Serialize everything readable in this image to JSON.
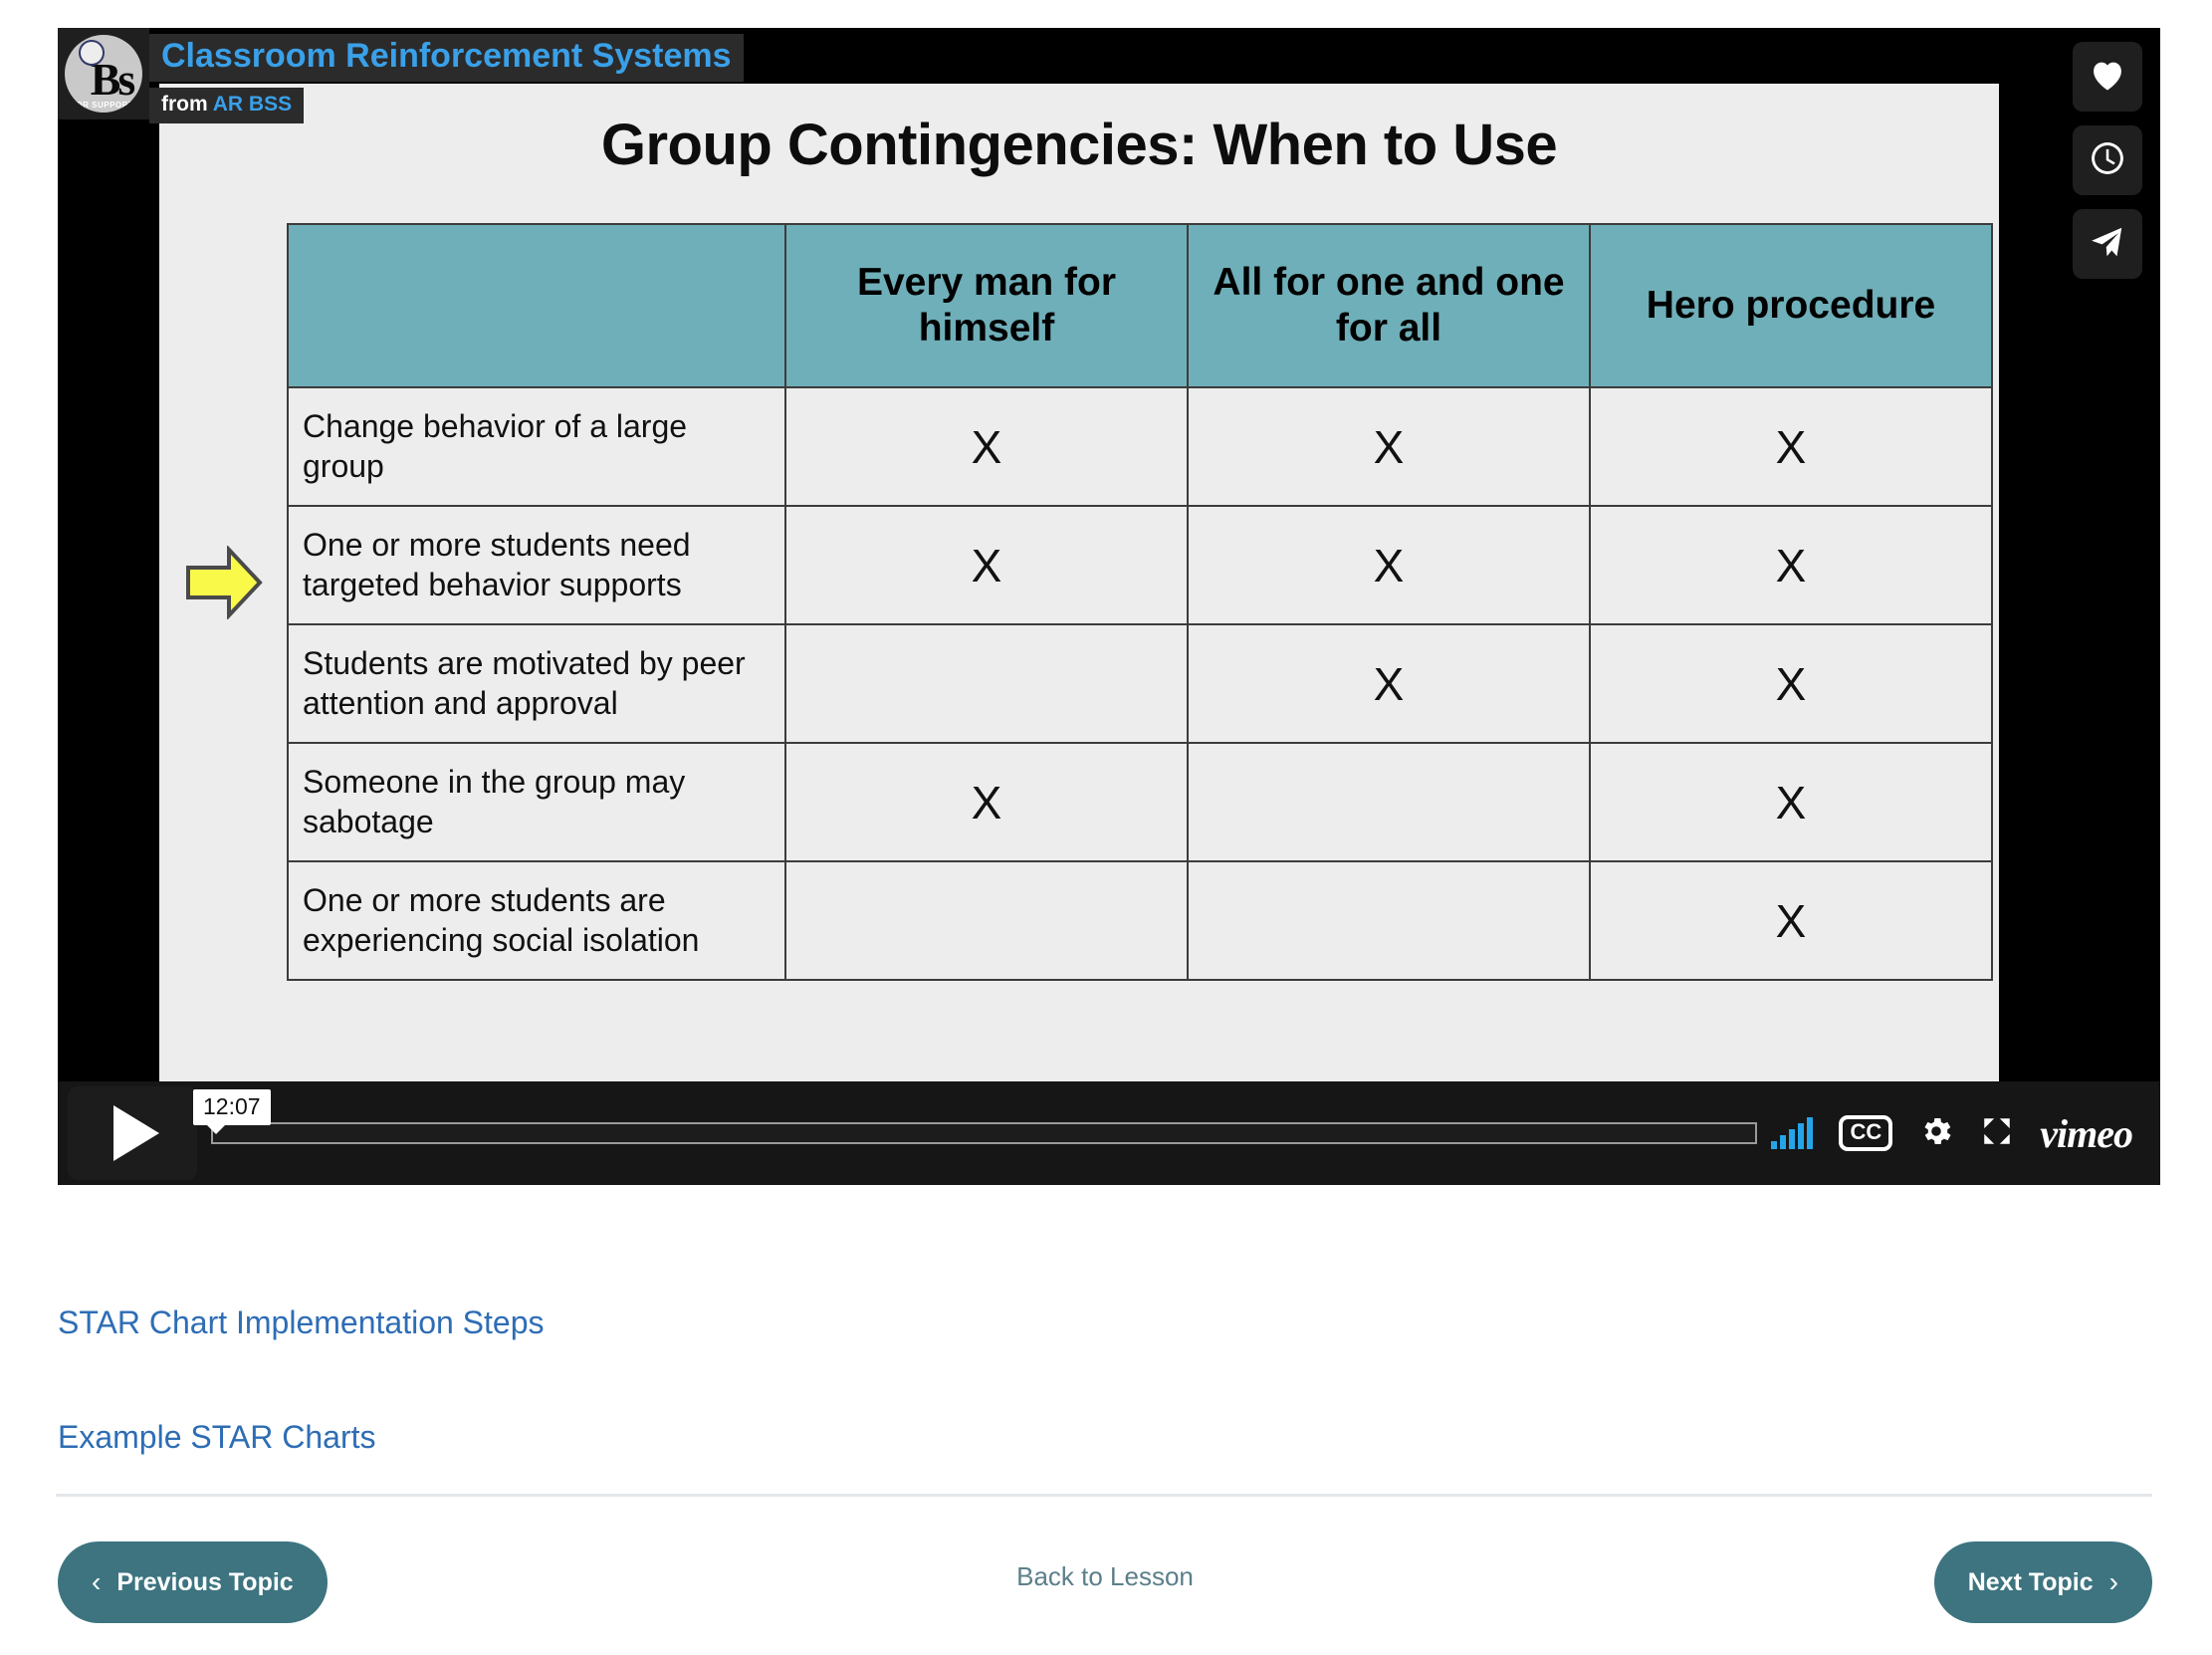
{
  "player": {
    "video_title": "Classroom Reinforcement Systems",
    "from_prefix": "from",
    "from_brand": "AR BSS",
    "avatar_initials": "Bs",
    "avatar_subtext": "IOR SUPPORT",
    "duration_tooltip": "12:07",
    "provider": "vimeo",
    "cc_label": "CC",
    "side_actions": [
      {
        "name": "like-button",
        "icon": "heart-icon"
      },
      {
        "name": "watch-later-button",
        "icon": "clock-icon"
      },
      {
        "name": "share-button",
        "icon": "paper-plane-icon"
      }
    ],
    "colors": {
      "accent_blue": "#3aa0e8",
      "volume_blue": "#26a4e8",
      "bar_background": "#161616"
    }
  },
  "slide": {
    "title": "Group Contingencies: When to Use",
    "annotation": "yellow-arrow pointing at row 3",
    "colors": {
      "header_teal": "#6fafb9",
      "cell_background": "#ededee",
      "arrow_yellow": "#f7f743"
    }
  },
  "chart_data": {
    "type": "table",
    "title": "Group Contingencies: When to Use",
    "categories": [
      "Change behavior of a large group",
      "One or more students need targeted behavior supports",
      "Students are motivated by peer attention and approval",
      "Someone in the group may sabotage",
      "One or more students are experiencing social isolation"
    ],
    "columns": [
      "",
      "Every man for himself",
      "All for one and one for all",
      "Hero procedure"
    ],
    "mark": "X",
    "rows": [
      {
        "label": "Change behavior of a large group",
        "marks": [
          "X",
          "X",
          "X"
        ]
      },
      {
        "label": "One or more students need targeted behavior supports",
        "marks": [
          "X",
          "X",
          "X"
        ]
      },
      {
        "label": "Students are motivated by peer attention and approval",
        "marks": [
          "",
          "X",
          "X"
        ]
      },
      {
        "label": "Someone in the group may sabotage",
        "marks": [
          "X",
          "",
          "X"
        ]
      },
      {
        "label": "One or more students are experiencing social isolation",
        "marks": [
          "",
          "",
          "X"
        ]
      }
    ]
  },
  "content": {
    "links": [
      {
        "label": "STAR Chart Implementation Steps"
      },
      {
        "label": "Example STAR Charts"
      }
    ]
  },
  "nav": {
    "previous_label": "Previous Topic",
    "back_label": "Back to Lesson",
    "next_label": "Next Topic",
    "prev_chevron": "‹",
    "next_chevron": "›",
    "button_color": "#3d7480"
  }
}
